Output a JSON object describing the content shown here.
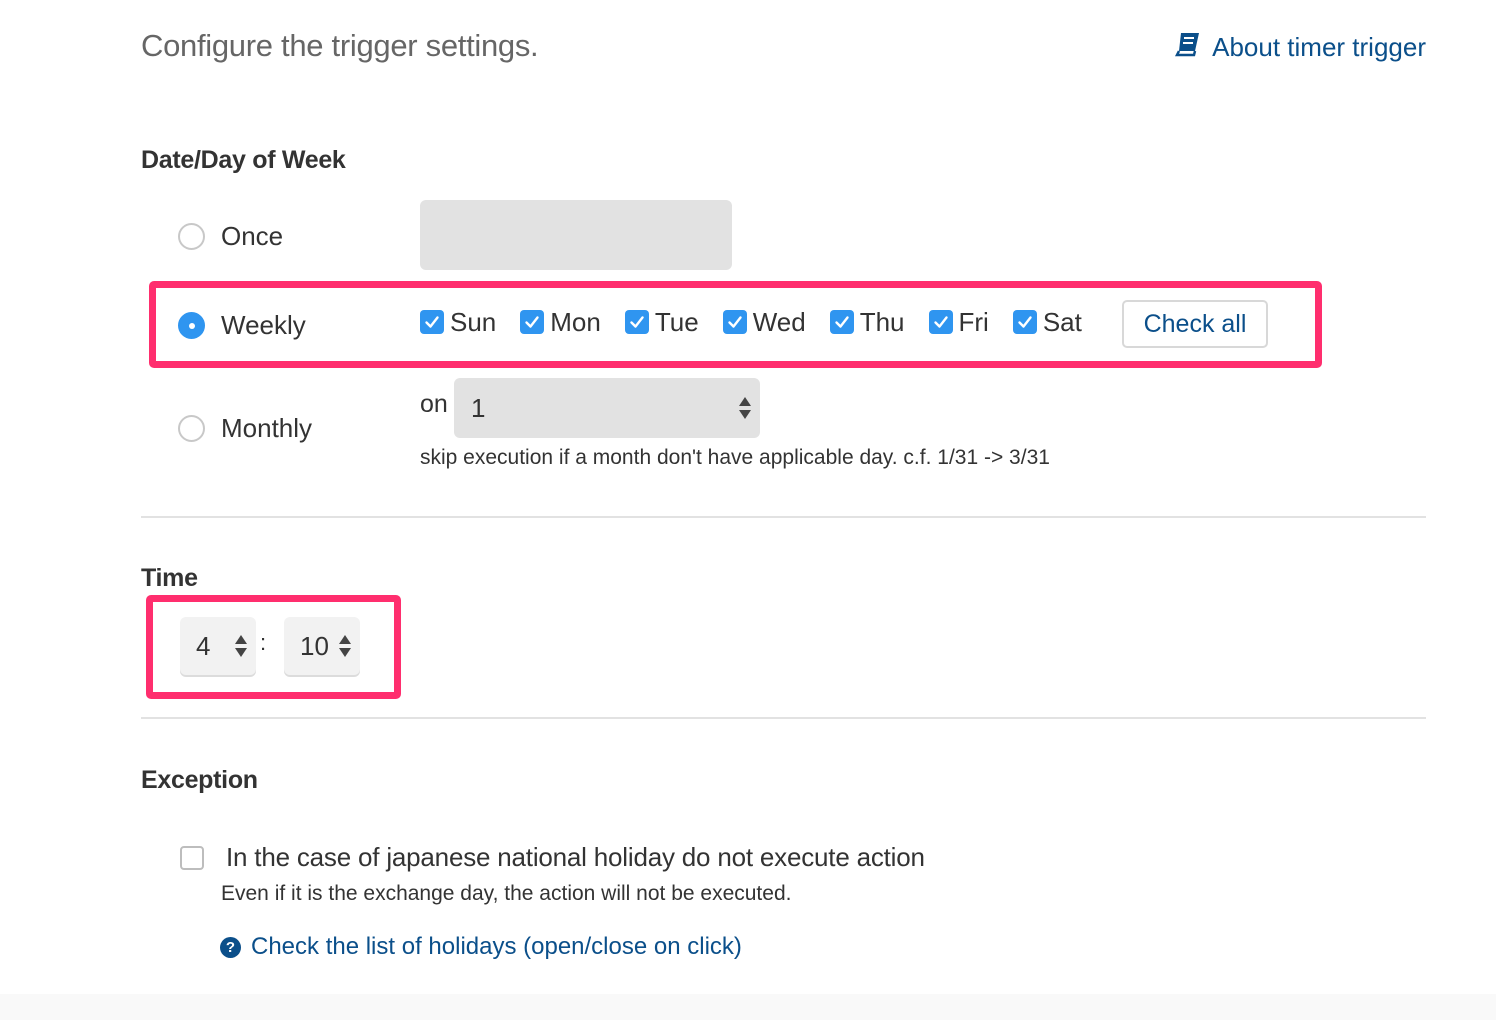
{
  "header": {
    "title": "Configure the trigger settings.",
    "help_link": "About timer trigger"
  },
  "date_section": {
    "title": "Date/Day of Week",
    "options": {
      "once": "Once",
      "weekly": "Weekly",
      "monthly": "Monthly"
    },
    "selected": "weekly",
    "weekly_days": [
      {
        "label": "Sun",
        "checked": true
      },
      {
        "label": "Mon",
        "checked": true
      },
      {
        "label": "Tue",
        "checked": true
      },
      {
        "label": "Wed",
        "checked": true
      },
      {
        "label": "Thu",
        "checked": true
      },
      {
        "label": "Fri",
        "checked": true
      },
      {
        "label": "Sat",
        "checked": true
      }
    ],
    "check_all_label": "Check all",
    "monthly": {
      "on_label": "on",
      "day_value": "1",
      "note": "skip execution if a month don't have applicable day. c.f. 1/31 -> 3/31"
    }
  },
  "time_section": {
    "title": "Time",
    "hour": "4",
    "separator": ":",
    "minute": "10"
  },
  "exception_section": {
    "title": "Exception",
    "holiday_checkbox": {
      "label": "In the case of japanese national holiday do not execute action",
      "checked": false
    },
    "note": "Even if it is the exchange day, the action will not be executed.",
    "holiday_list_link": "Check the list of holidays (open/close on click)"
  },
  "colors": {
    "accent": "#2f95f0",
    "link": "#0b4f8a",
    "highlight": "#ff2e6e"
  }
}
